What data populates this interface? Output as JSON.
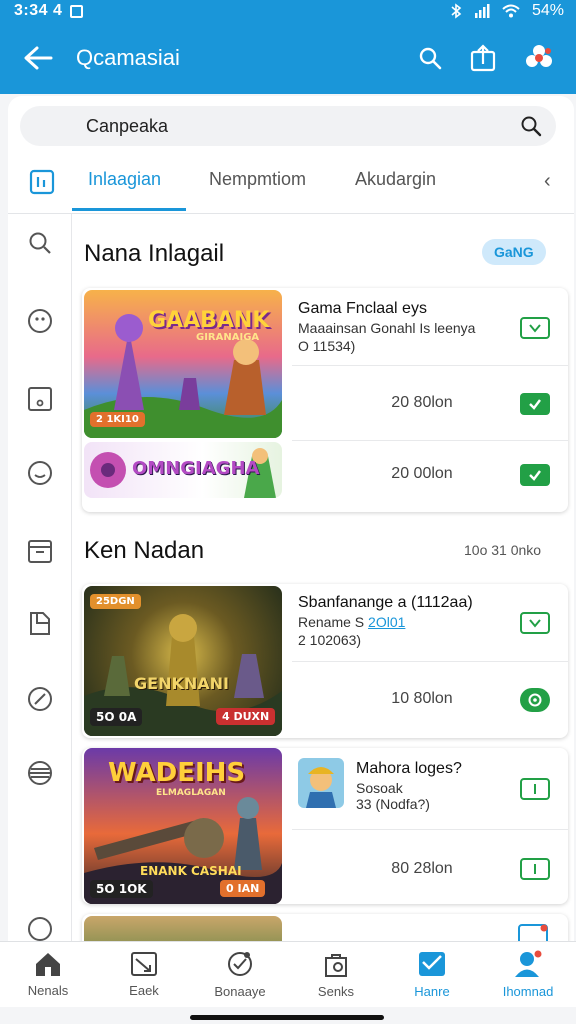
{
  "status_bar": {
    "time": "3:34 4",
    "battery": "54%"
  },
  "app_bar": {
    "title": "Qcamasiai"
  },
  "search": {
    "value": "Canpeaka"
  },
  "tabs": [
    {
      "label": "Inlaagian",
      "active": true
    },
    {
      "label": "Nempmtiom",
      "active": false
    },
    {
      "label": "Akudargin",
      "active": false
    }
  ],
  "rail_icons": [
    "search-icon",
    "badge-icon",
    "square-icon",
    "smiley-icon",
    "calendar-icon",
    "document-icon",
    "compass-icon",
    "menu-icon"
  ],
  "section1": {
    "title": "Nana Inlagail",
    "badge": "GaNG"
  },
  "card1": {
    "thumb1_title": "GAABANK",
    "thumb1_sub": "GIRANAIGA",
    "thumb1_tag": "2 1KI10",
    "thumb2_title": "OMNGIAGHA",
    "row1_title": "Gama Fnclaal eys",
    "row1_sub": "Maaainsan Gonahl Is leenya",
    "row1_meta": "O 11534)",
    "row2_value": "20 80lon",
    "row3_value": "20 00lon"
  },
  "section2": {
    "title": "Ken Nadan",
    "meta": "10o 31 0nko"
  },
  "card2": {
    "thumb_tag": "25DGN",
    "thumb_title": "GENKNANI",
    "thumb_left": "5O 0A",
    "thumb_right": "4 DUXN",
    "row1_title": "Sbanfanange a (1112aa)",
    "row1_sub_prefix": "Rename S",
    "row1_sub_link": "2Ol01",
    "row1_meta": "2 102063)",
    "row2_value": "10 80lon"
  },
  "card3": {
    "thumb_title": "WADEIHS",
    "thumb_sub": "ELMAGLAGAN",
    "thumb_bottom": "ENANK CASHAI",
    "thumb_left": "5O 1OK",
    "thumb_right": "0 IAN",
    "row1_title": "Mahora loges?",
    "row1_sub": "Sosoak",
    "row1_meta": "33 (Nodfa?)",
    "row2_value": "80 28lon"
  },
  "bottom_nav": [
    {
      "label": "Nenals",
      "icon": "home-icon",
      "active": false
    },
    {
      "label": "Eaek",
      "icon": "chart-icon",
      "active": false
    },
    {
      "label": "Bonaaye",
      "icon": "chat-icon",
      "active": false
    },
    {
      "label": "Senks",
      "icon": "bag-icon",
      "active": false
    },
    {
      "label": "Hanre",
      "icon": "inbox-icon",
      "active": true
    },
    {
      "label": "Ihomnad",
      "icon": "profile-icon",
      "active": true
    }
  ],
  "colors": {
    "primary": "#1a96d9",
    "accent_green": "#22a046",
    "rail_accent": "#e8703a"
  }
}
